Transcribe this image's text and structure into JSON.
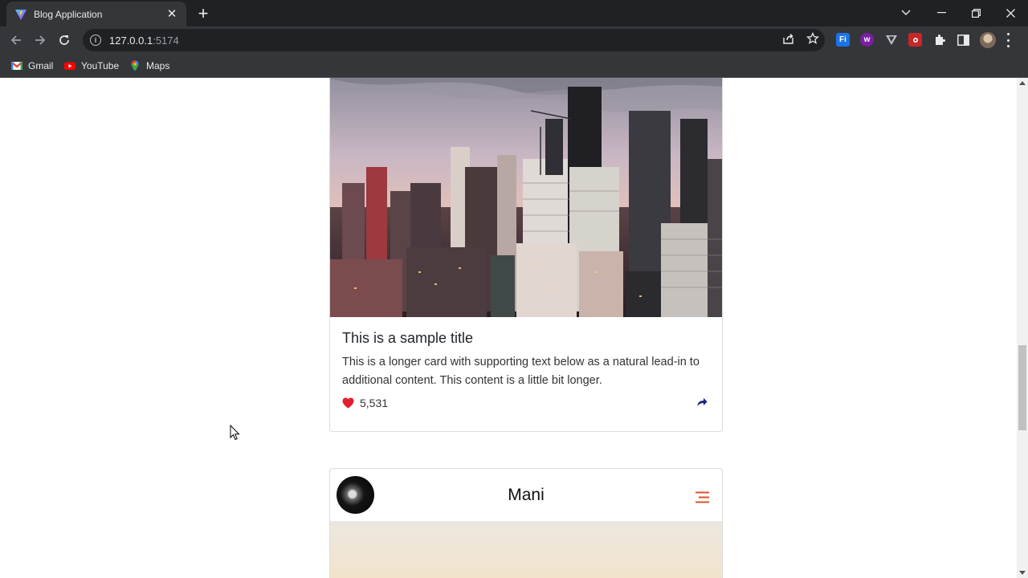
{
  "browser": {
    "tab": {
      "title": "Blog Application"
    },
    "address": {
      "host": "127.0.0.1",
      "port": ":5174"
    },
    "bookmarks": [
      {
        "label": "Gmail",
        "icon": "gmail-icon"
      },
      {
        "label": "YouTube",
        "icon": "youtube-icon"
      },
      {
        "label": "Maps",
        "icon": "maps-icon"
      }
    ],
    "extensions": [
      {
        "icon": "fi-extension-icon",
        "text": "Fi",
        "color": "#1a73e8"
      },
      {
        "icon": "w-extension-icon",
        "text": "w",
        "color": "#7b1fa2"
      },
      {
        "icon": "v-extension-icon",
        "text": "",
        "color": "#9aa0a6"
      },
      {
        "icon": "red-extension-icon",
        "text": "",
        "color": "#c62828"
      }
    ]
  },
  "posts": [
    {
      "title": "This is a sample title",
      "text": "This is a longer card with supporting text below as a natural lead-in to additional content. This content is a little bit longer.",
      "likes": "5,531",
      "image": "city-skyline-image"
    },
    {
      "author": "Mani",
      "image": "sky-image"
    }
  ],
  "colors": {
    "heart": "#e0202f",
    "share": "#1a237e",
    "menu": "#e0502a"
  }
}
